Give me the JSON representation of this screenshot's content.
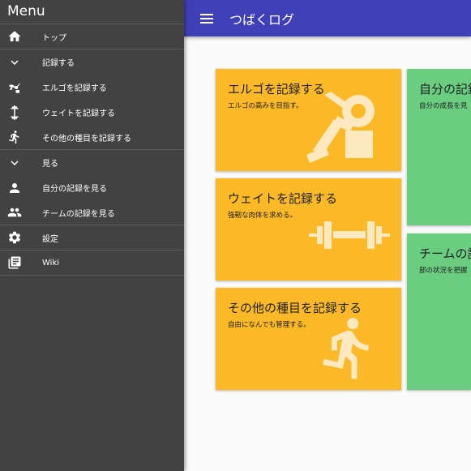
{
  "drawer": {
    "title": "Menu",
    "items": [
      {
        "icon": "home-icon",
        "label": "トップ"
      },
      {
        "icon": "chevron-down-icon",
        "label": "記録する"
      },
      {
        "icon": "rowing-icon",
        "label": "エルゴを記録する"
      },
      {
        "icon": "dumbbell-icon",
        "label": "ウェイトを記録する"
      },
      {
        "icon": "running-icon",
        "label": "その他の種目を記録する"
      },
      {
        "icon": "chevron-down-icon",
        "label": "見る"
      },
      {
        "icon": "person-icon",
        "label": "自分の記録を見る"
      },
      {
        "icon": "group-icon",
        "label": "チームの記録を見る"
      },
      {
        "icon": "gear-icon",
        "label": "設定"
      },
      {
        "icon": "library-books-icon",
        "label": "Wiki"
      }
    ]
  },
  "appbar": {
    "menu_icon": "hamburger-icon",
    "title": "つばくログ"
  },
  "cards": {
    "ergo": {
      "title": "エルゴを記録する",
      "subtitle": "エルゴの高みを目指す。",
      "color": "#fbb928",
      "icon": "rowing-icon"
    },
    "weight": {
      "title": "ウェイトを記録する",
      "subtitle": "強靭な肉体を求める。",
      "color": "#fbb928",
      "icon": "dumbbell-icon"
    },
    "other": {
      "title": "その他の種目を記録する",
      "subtitle": "自由になんでも管理する。",
      "color": "#fbb928",
      "icon": "running-icon"
    },
    "mine": {
      "title": "自分の記録",
      "subtitle": "自分の成長を見",
      "color": "#6acd80"
    },
    "team": {
      "title": "チームの記",
      "subtitle": "部の状況を把握",
      "color": "#6acd80"
    }
  },
  "colors": {
    "drawer_bg": "#424242",
    "appbar_bg": "#3f40b8",
    "card_yellow": "#fbb928",
    "card_green": "#6acd80"
  }
}
